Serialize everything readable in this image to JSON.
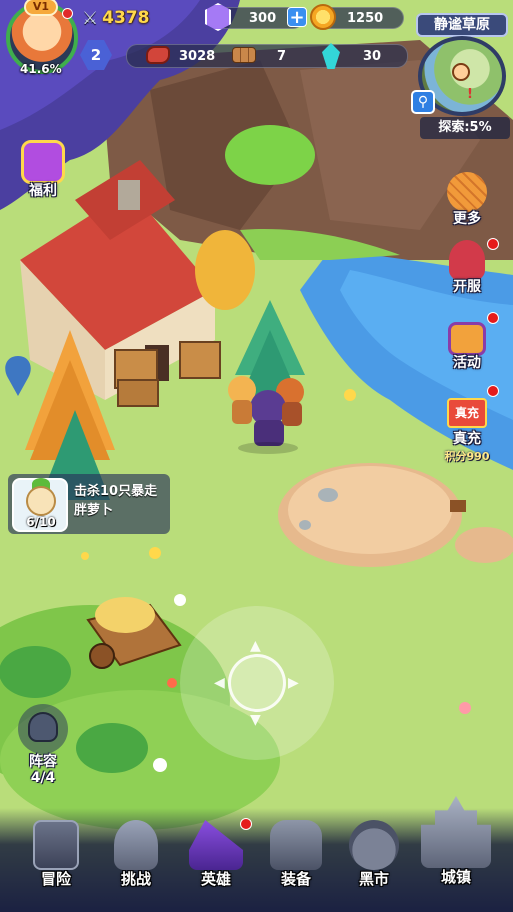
{
  "player": {
    "vip": "V1",
    "progress": "41.6%",
    "level": "2",
    "power": "4378"
  },
  "currency": {
    "gems": "300",
    "gold": "1250"
  },
  "resources": {
    "meat": "3028",
    "wood": "7",
    "crystal": "30"
  },
  "map": {
    "region": "静谧草原",
    "explore": "探索:5%",
    "marker": "!"
  },
  "side_left": {
    "welfare": "福利"
  },
  "side_right": {
    "more": "更多",
    "open_server": "开服",
    "activity": "活动",
    "recharge": "真充",
    "recharge_badge": "真充",
    "points": "积分990"
  },
  "quest": {
    "text": "击杀10只暴走胖萝卜",
    "progress": "6/10"
  },
  "lineup": {
    "label": "阵容",
    "count": "4/4"
  },
  "nav": {
    "adventure": "冒险",
    "challenge": "挑战",
    "heroes": "英雄",
    "equipment": "装备",
    "black_market": "黑市",
    "town": "城镇"
  },
  "colors": {
    "grass": "#b9dd7a",
    "water": "#4b9be6",
    "roof": "#d2473b",
    "forest_shadow": "#4b3fa0",
    "nav_bg": "#1b2142",
    "alert": "#e51b1b"
  }
}
